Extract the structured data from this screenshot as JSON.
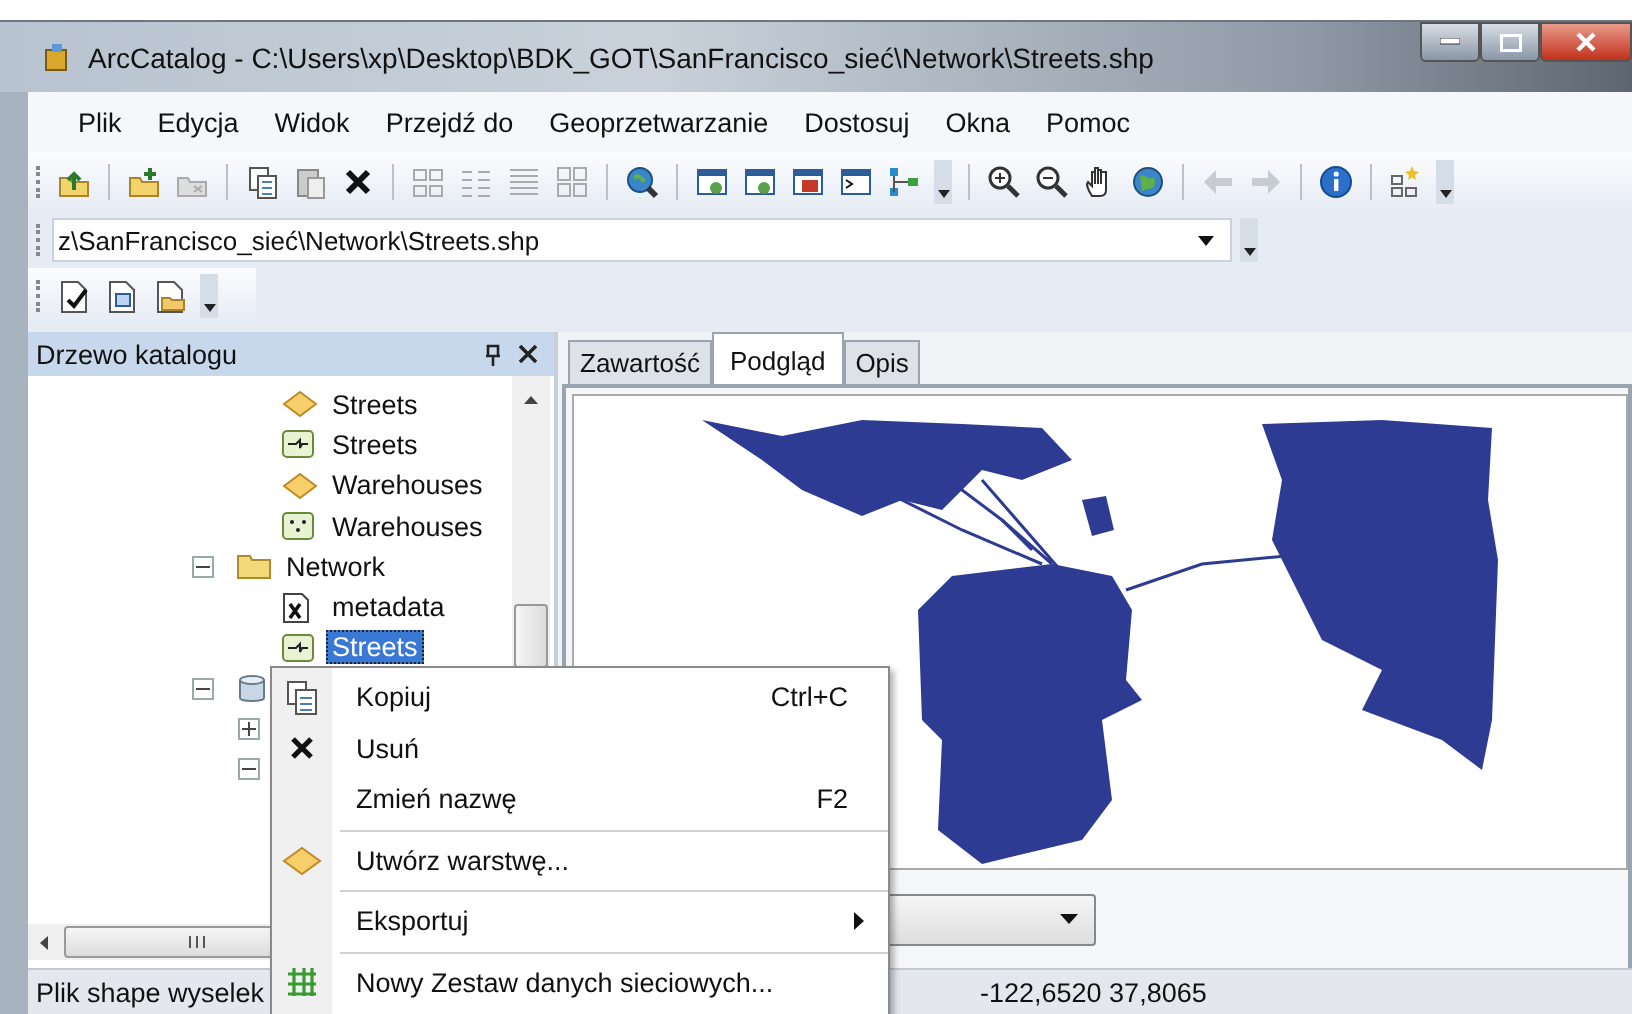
{
  "window": {
    "title": "ArcCatalog - C:\\Users\\xp\\Desktop\\BDK_GOT\\SanFrancisco_sieć\\Network\\Streets.shp"
  },
  "menu": [
    "Plik",
    "Edycja",
    "Widok",
    "Przejdź do",
    "Geoprzetwarzanie",
    "Dostosuj",
    "Okna",
    "Pomoc"
  ],
  "address": {
    "value": "z\\SanFrancisco_sieć\\Network\\Streets.shp"
  },
  "catalog_tree": {
    "title": "Drzewo katalogu",
    "nodes": [
      {
        "children": [
          {
            "kind": "layer",
            "label": "Streets",
            "selected": false
          },
          {
            "kind": "line",
            "label": "Streets",
            "selected": false
          },
          {
            "kind": "layer",
            "label": "Warehouses",
            "selected": false
          },
          {
            "kind": "point",
            "label": "Warehouses",
            "selected": false
          }
        ]
      },
      {
        "kind": "folder",
        "label": "Network",
        "selected": false,
        "expanded": true,
        "children": [
          {
            "kind": "metadata",
            "label": "metadata",
            "selected": false
          },
          {
            "kind": "line",
            "label": "Streets",
            "selected": true
          }
        ]
      },
      {
        "kind": "database",
        "expanded": true,
        "children": [
          {
            "expanded": false
          },
          {
            "expanded": true
          }
        ]
      }
    ]
  },
  "tabs": [
    {
      "label": "Zawartość",
      "selected": false
    },
    {
      "label": "Podgląd",
      "selected": true
    },
    {
      "label": "Opis",
      "selected": false
    }
  ],
  "context_menu": {
    "items": [
      {
        "kind": "item",
        "label": "Kopiuj",
        "shortcut": "Ctrl+C",
        "submenu": false
      },
      {
        "kind": "item",
        "label": "Usuń",
        "submenu": false
      },
      {
        "kind": "item",
        "label": "Zmień nazwę",
        "shortcut": "F2",
        "submenu": false
      },
      {
        "kind": "separator"
      },
      {
        "kind": "item",
        "label": "Utwórz warstwę...",
        "submenu": false
      },
      {
        "kind": "separator"
      },
      {
        "kind": "item",
        "label": "Eksportuj",
        "submenu": true
      },
      {
        "kind": "separator"
      },
      {
        "kind": "item",
        "label": "Nowy Zestaw danych sieciowych...",
        "submenu": false
      }
    ]
  },
  "status_bar": {
    "message": "Plik shape wyselek",
    "coordinates": "-122,6520  37,8065"
  }
}
